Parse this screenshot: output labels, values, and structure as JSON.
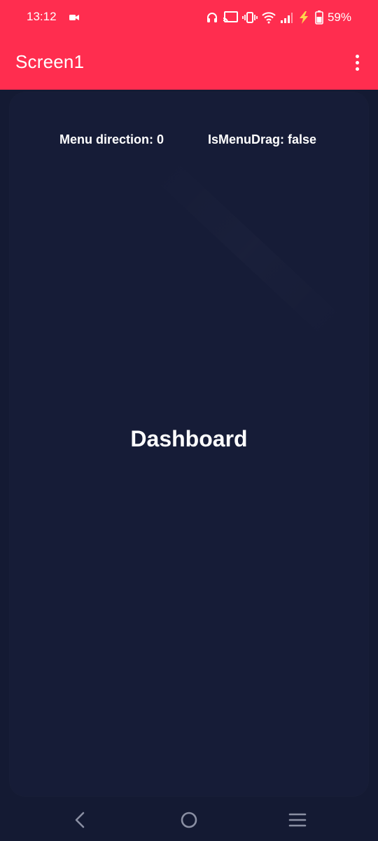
{
  "status_bar": {
    "time": "13:12",
    "battery_percent": "59%",
    "icons": [
      "video-camera-icon",
      "headphones-icon",
      "cast-icon",
      "vibrate-icon",
      "wifi-icon",
      "signal-icon",
      "charging-bolt-icon",
      "battery-icon"
    ]
  },
  "app_bar": {
    "title": "Screen1",
    "menu_icon": "overflow-menu-icon",
    "background_color": "#ff2d4f"
  },
  "content": {
    "menu_direction_label": "Menu direction: 0",
    "is_menu_drag_label": "IsMenuDrag: false",
    "title": "Dashboard",
    "background_color": "#161c37"
  },
  "nav_bar": {
    "icons": [
      "back-icon",
      "home-icon",
      "recents-menu-icon"
    ]
  }
}
